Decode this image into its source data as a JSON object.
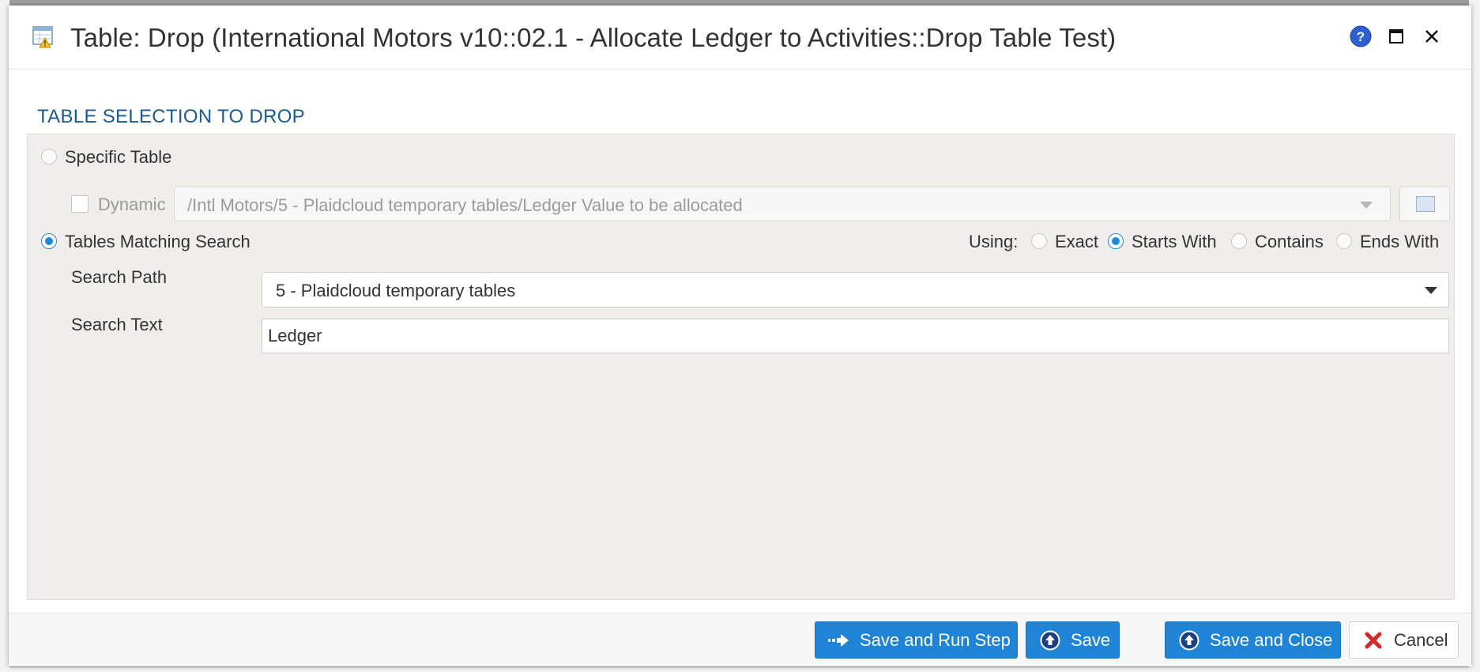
{
  "dialog": {
    "title": "Table: Drop (International Motors v10::02.1 - Allocate Ledger to Activities::Drop Table Test)",
    "icons": {
      "title": "table-drop-icon",
      "help": "help-icon",
      "maximize": "maximize-icon",
      "close": "close-icon"
    }
  },
  "section": {
    "title": "TABLE SELECTION TO DROP"
  },
  "specific_table": {
    "label": "Specific Table",
    "selected": false,
    "dynamic_label": "Dynamic",
    "dynamic_checked": false,
    "table_path": "/Intl Motors/5 - Plaidcloud temporary tables/Ledger Value to be allocated",
    "picker_icon": "table-picker-icon"
  },
  "search": {
    "label": "Tables Matching Search",
    "selected": true,
    "using_label": "Using:",
    "modes": [
      {
        "label": "Exact",
        "selected": false
      },
      {
        "label": "Starts With",
        "selected": true
      },
      {
        "label": "Contains",
        "selected": false
      },
      {
        "label": "Ends With",
        "selected": false
      }
    ],
    "path_label": "Search Path",
    "path_value": "5 - Plaidcloud temporary tables",
    "text_label": "Search Text",
    "text_value": "Ledger"
  },
  "footer": {
    "save_run_label": "Save and Run Step",
    "save_label": "Save",
    "save_close_label": "Save and Close",
    "cancel_label": "Cancel"
  },
  "colors": {
    "accent": "#1f84d6",
    "section_title": "#1c5a8f",
    "panel_bg": "#efeeeb",
    "cancel_icon": "#d42a2a"
  }
}
